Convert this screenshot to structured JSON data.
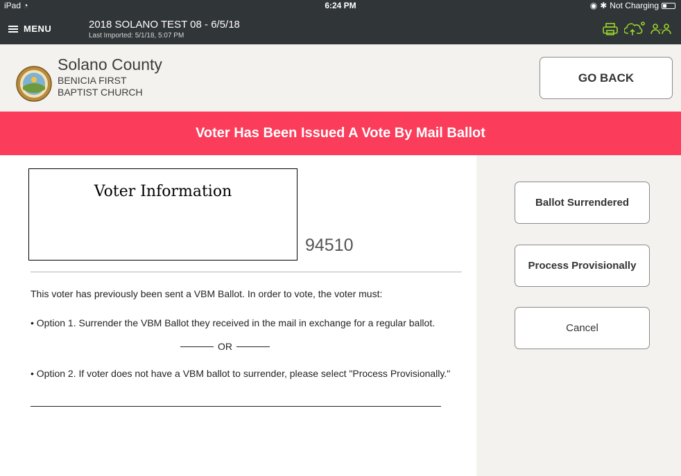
{
  "status_bar": {
    "device": "iPad",
    "time": "6:24 PM",
    "charging": "Not Charging"
  },
  "app_bar": {
    "menu_label": "MENU",
    "title": "2018 SOLANO TEST 08 - 6/5/18",
    "subtitle": "Last Imported: 5/1/18, 5:07 PM",
    "accent_color": "#9bd42a",
    "icons": [
      "printer-icon",
      "cloud-sync-icon",
      "users-icon"
    ]
  },
  "header": {
    "county": "Solano County",
    "site_line1": "BENICIA FIRST",
    "site_line2": "BAPTIST CHURCH",
    "go_back_label": "GO BACK"
  },
  "banner": {
    "text": "Voter Has Been Issued A Vote By Mail Ballot",
    "color": "#fb3c5a"
  },
  "voter": {
    "box_title": "Voter Information",
    "zip": "94510"
  },
  "instructions": {
    "intro": "This voter has previously been sent a VBM Ballot. In order to vote, the voter must:",
    "option1": "• Option 1. Surrender the VBM Ballot they received in the mail  in exchange for a regular ballot.",
    "or": "OR",
    "option2": "• Option 2. If voter does not have a VBM ballot to surrender, please select \"Process Provisionally.\""
  },
  "actions": {
    "surrender": "Ballot Surrendered",
    "provisional": "Process Provisionally",
    "cancel": "Cancel"
  }
}
